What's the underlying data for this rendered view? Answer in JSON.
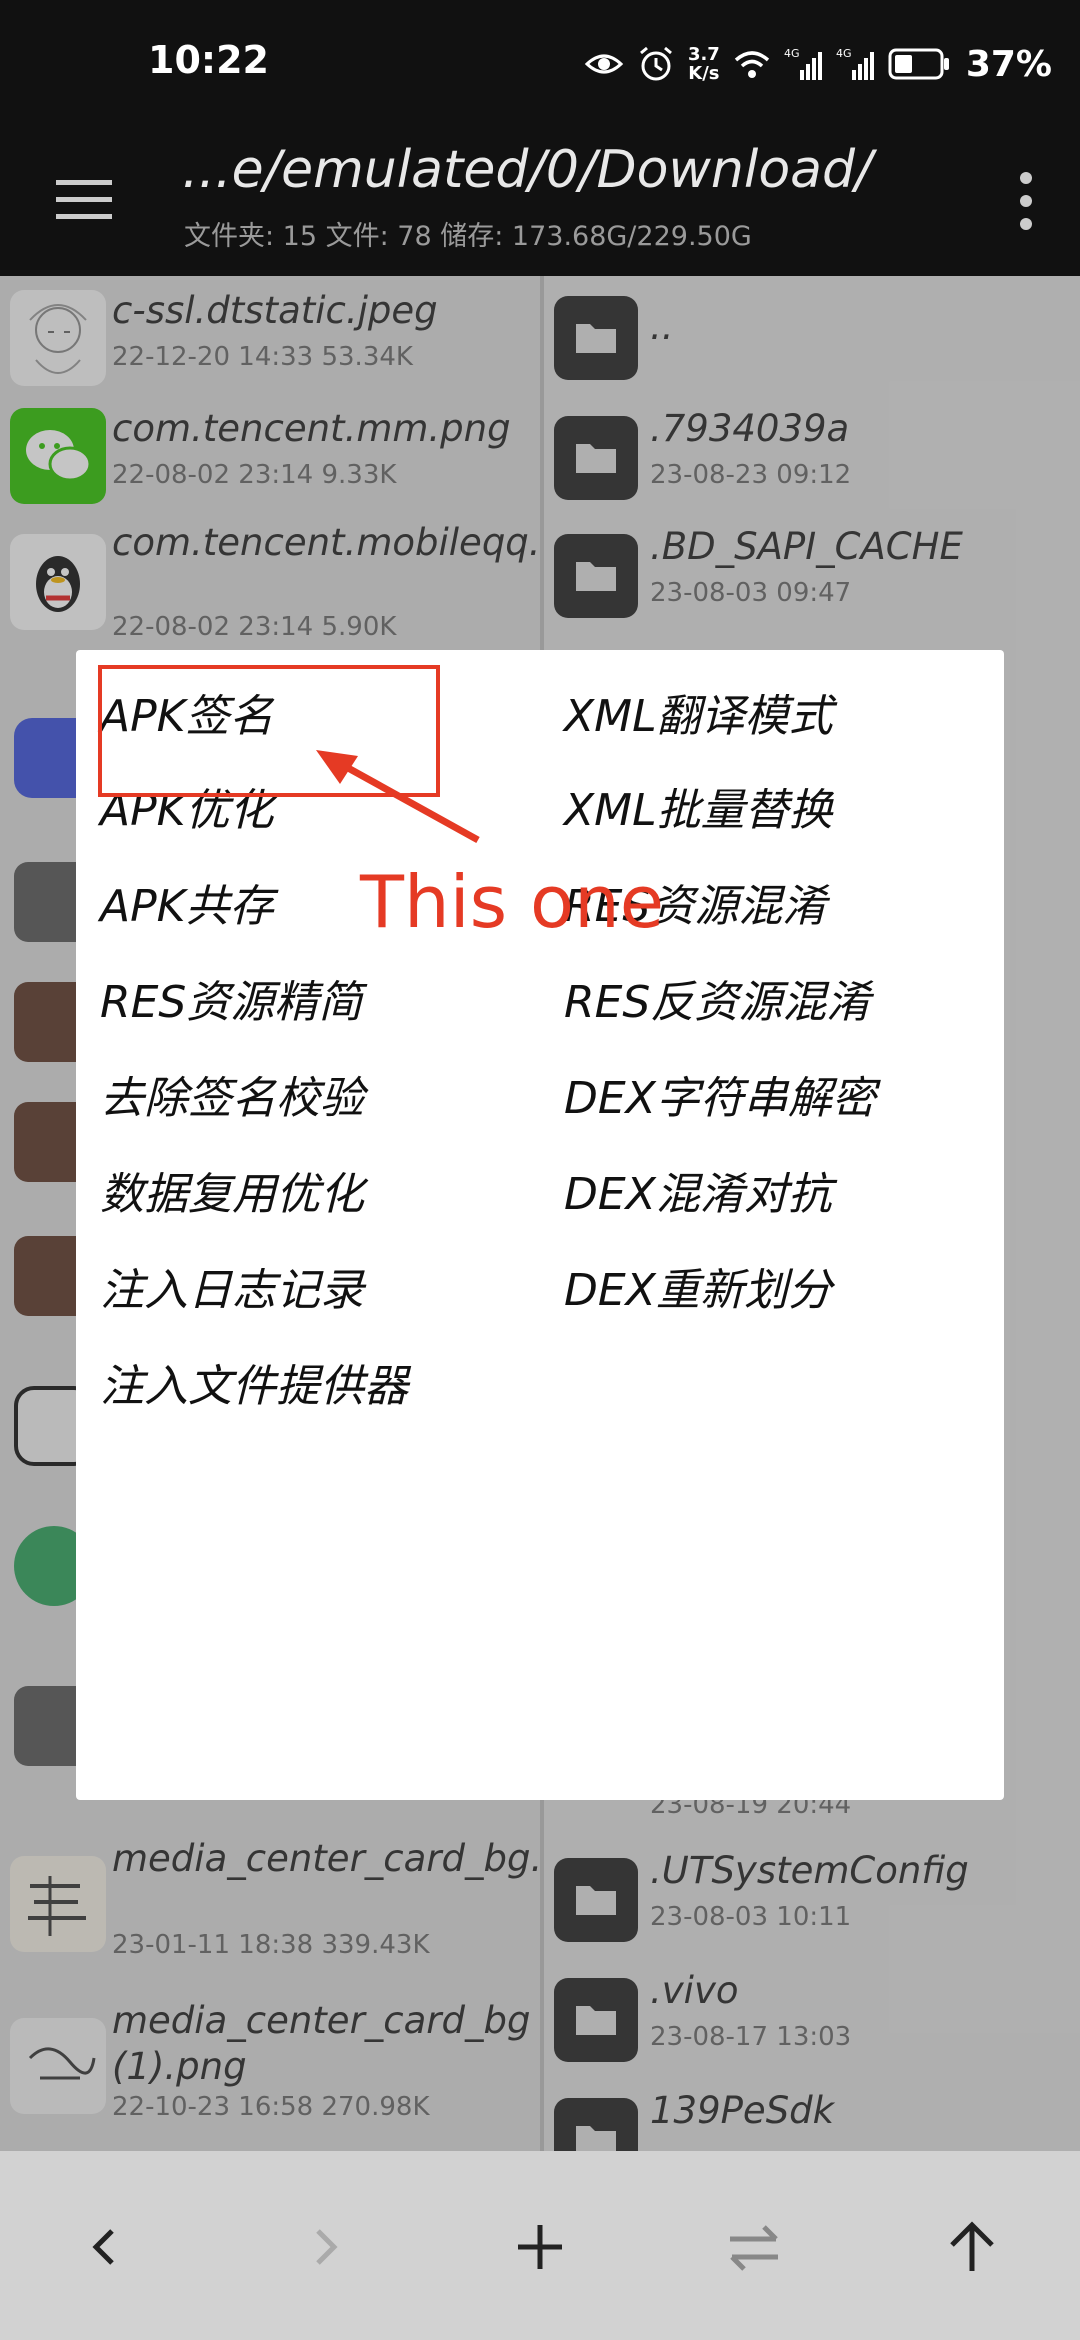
{
  "status_bar": {
    "time": "10:22",
    "speed_value": "3.7",
    "speed_unit": "K/s",
    "battery": "37%",
    "icons": [
      "eye-icon",
      "alarm-icon",
      "wifi-icon",
      "signal-4g-icon",
      "signal-4g-icon",
      "battery-icon"
    ]
  },
  "toolbar": {
    "path": "...e/emulated/0/Download/",
    "storage": "文件夹: 15  文件: 78  储存: 173.68G/229.50G"
  },
  "left_files": [
    {
      "name": "c-ssl.dtstatic.jpeg",
      "meta": "22-12-20 14:33  53.34K",
      "thumb": "anime-sketch"
    },
    {
      "name": "com.tencent.mm.png",
      "meta": "22-08-02 23:14  9.33K",
      "thumb": "wechat-icon"
    },
    {
      "name": "com.tencent.mobileqq.png",
      "meta": "22-08-02 23:14  5.90K",
      "thumb": "qq-icon"
    },
    {
      "name": "media_center_card_bg.png",
      "meta": "23-01-11 18:38  339.43K",
      "thumb": "calligraphy"
    },
    {
      "name": "media_center_card_bg (1).png",
      "meta": "22-10-23 16:58  270.98K",
      "thumb": "calligraphy"
    }
  ],
  "right_files": [
    {
      "name": "..",
      "meta": ""
    },
    {
      "name": ".7934039a",
      "meta": "23-08-23 09:12"
    },
    {
      "name": ".BD_SAPI_CACHE",
      "meta": "23-08-03 09:47"
    },
    {
      "name": "",
      "meta": "23-08-19 20:44"
    },
    {
      "name": ".UTSystemConfig",
      "meta": "23-08-03 10:11"
    },
    {
      "name": ".vivo",
      "meta": "23-08-17 13:03"
    },
    {
      "name": "139PeSdk",
      "meta": ""
    }
  ],
  "dialog": {
    "left_options": [
      "APK签名",
      "APK优化",
      "APK共存",
      "RES资源精简",
      "去除签名校验",
      "数据复用优化",
      "注入日志记录",
      "注入文件提供器"
    ],
    "right_options": [
      "XML翻译模式",
      "XML批量替换",
      "RES资源混淆",
      "RES反资源混淆",
      "DEX字符串解密",
      "DEX混淆对抗",
      "DEX重新划分"
    ]
  },
  "annotation": {
    "label": "This one",
    "color": "#e53a24"
  },
  "bottom_nav": [
    "back-icon",
    "forward-icon",
    "add-icon",
    "swap-icon",
    "up-icon"
  ]
}
